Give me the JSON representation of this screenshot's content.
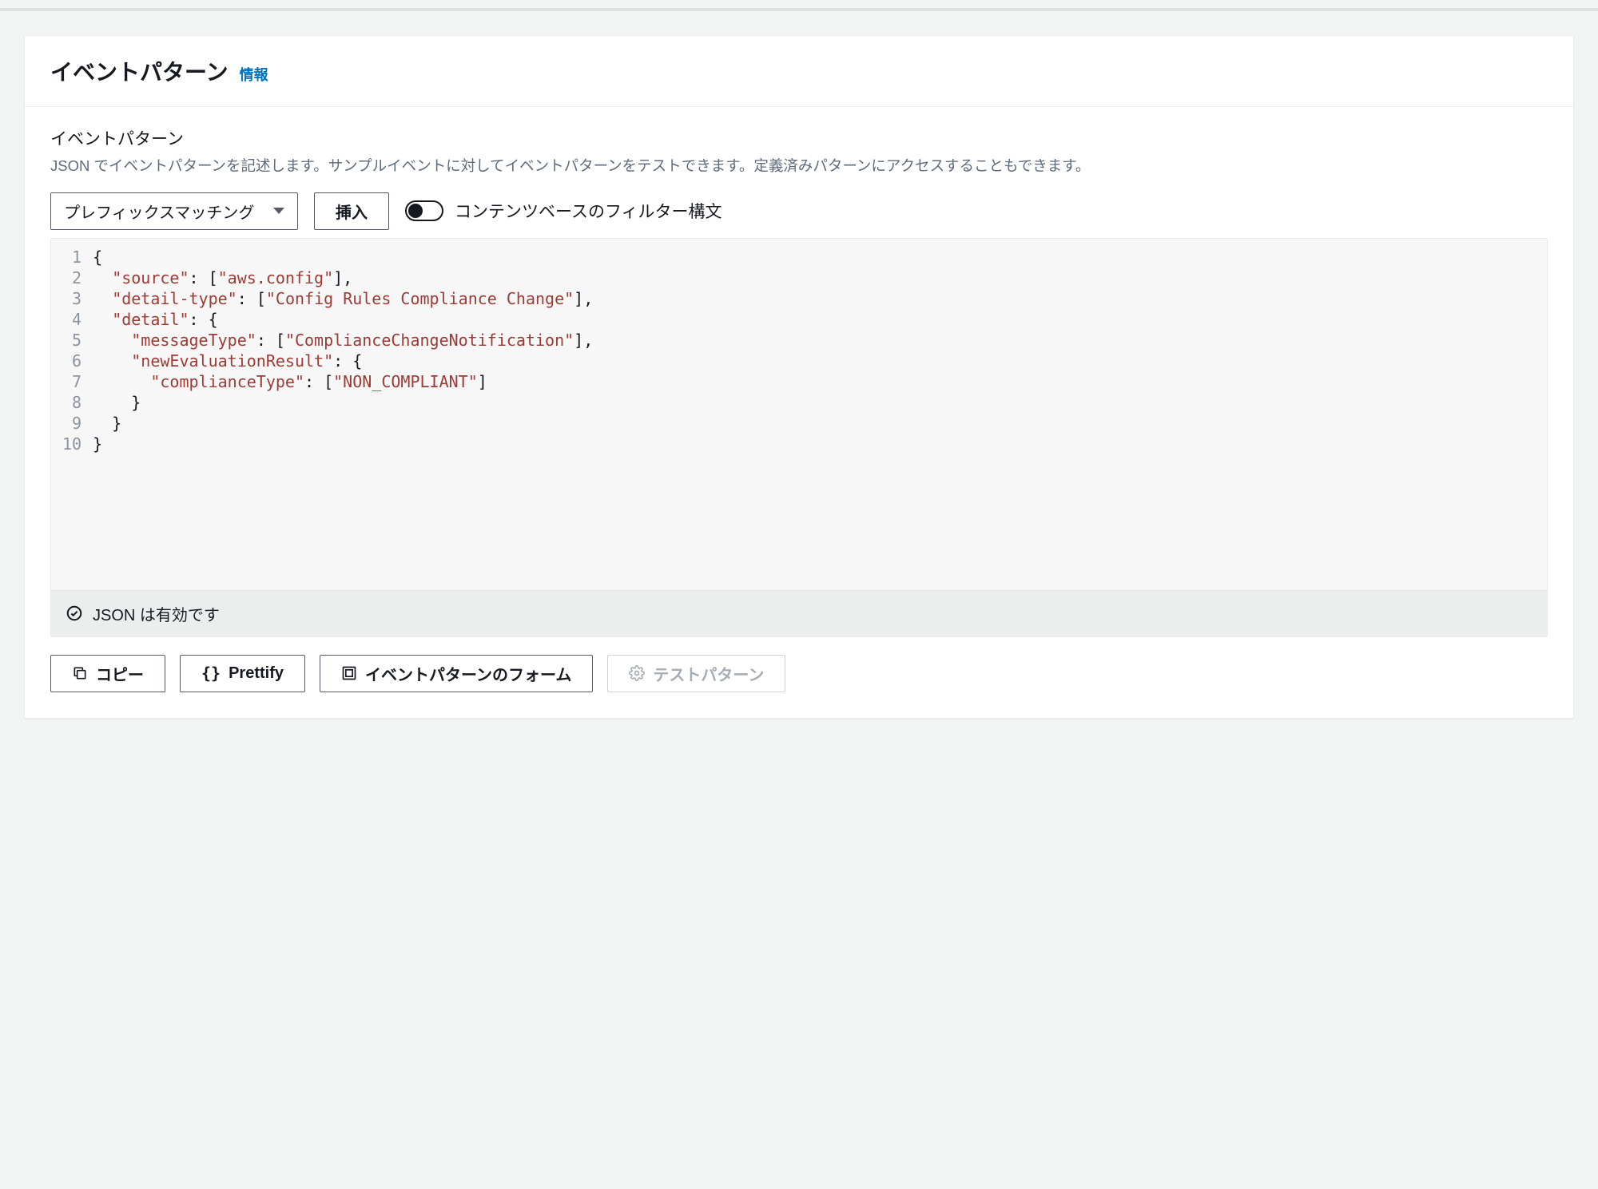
{
  "header": {
    "title": "イベントパターン",
    "info": "情報"
  },
  "section": {
    "label": "イベントパターン",
    "description": "JSON でイベントパターンを記述します。サンプルイベントに対してイベントパターンをテストできます。定義済みパターンにアクセスすることもできます。"
  },
  "controls": {
    "dropdown_label": "プレフィックスマッチング",
    "insert_button": "挿入",
    "toggle_label": "コンテンツベースのフィルター構文"
  },
  "editor": {
    "lines": [
      "1",
      "2",
      "3",
      "4",
      "5",
      "6",
      "7",
      "8",
      "9",
      "10"
    ],
    "code_tokens": [
      [
        {
          "t": "p",
          "v": "{"
        }
      ],
      [
        {
          "t": "p",
          "v": "  "
        },
        {
          "t": "k",
          "v": "\"source\""
        },
        {
          "t": "p",
          "v": ": ["
        },
        {
          "t": "s",
          "v": "\"aws.config\""
        },
        {
          "t": "p",
          "v": "],"
        }
      ],
      [
        {
          "t": "p",
          "v": "  "
        },
        {
          "t": "k",
          "v": "\"detail-type\""
        },
        {
          "t": "p",
          "v": ": ["
        },
        {
          "t": "s",
          "v": "\"Config Rules Compliance Change\""
        },
        {
          "t": "p",
          "v": "],"
        }
      ],
      [
        {
          "t": "p",
          "v": "  "
        },
        {
          "t": "k",
          "v": "\"detail\""
        },
        {
          "t": "p",
          "v": ": {"
        }
      ],
      [
        {
          "t": "p",
          "v": "    "
        },
        {
          "t": "k",
          "v": "\"messageType\""
        },
        {
          "t": "p",
          "v": ": ["
        },
        {
          "t": "s",
          "v": "\"ComplianceChangeNotification\""
        },
        {
          "t": "p",
          "v": "],"
        }
      ],
      [
        {
          "t": "p",
          "v": "    "
        },
        {
          "t": "k",
          "v": "\"newEvaluationResult\""
        },
        {
          "t": "p",
          "v": ": {"
        }
      ],
      [
        {
          "t": "p",
          "v": "      "
        },
        {
          "t": "k",
          "v": "\"complianceType\""
        },
        {
          "t": "p",
          "v": ": ["
        },
        {
          "t": "s",
          "v": "\"NON_COMPLIANT\""
        },
        {
          "t": "p",
          "v": "]"
        }
      ],
      [
        {
          "t": "p",
          "v": "    }"
        }
      ],
      [
        {
          "t": "p",
          "v": "  }"
        }
      ],
      [
        {
          "t": "p",
          "v": "}"
        }
      ]
    ],
    "status": "JSON は有効です"
  },
  "actions": {
    "copy": "コピー",
    "prettify": "Prettify",
    "form": "イベントパターンのフォーム",
    "test": "テストパターン"
  }
}
